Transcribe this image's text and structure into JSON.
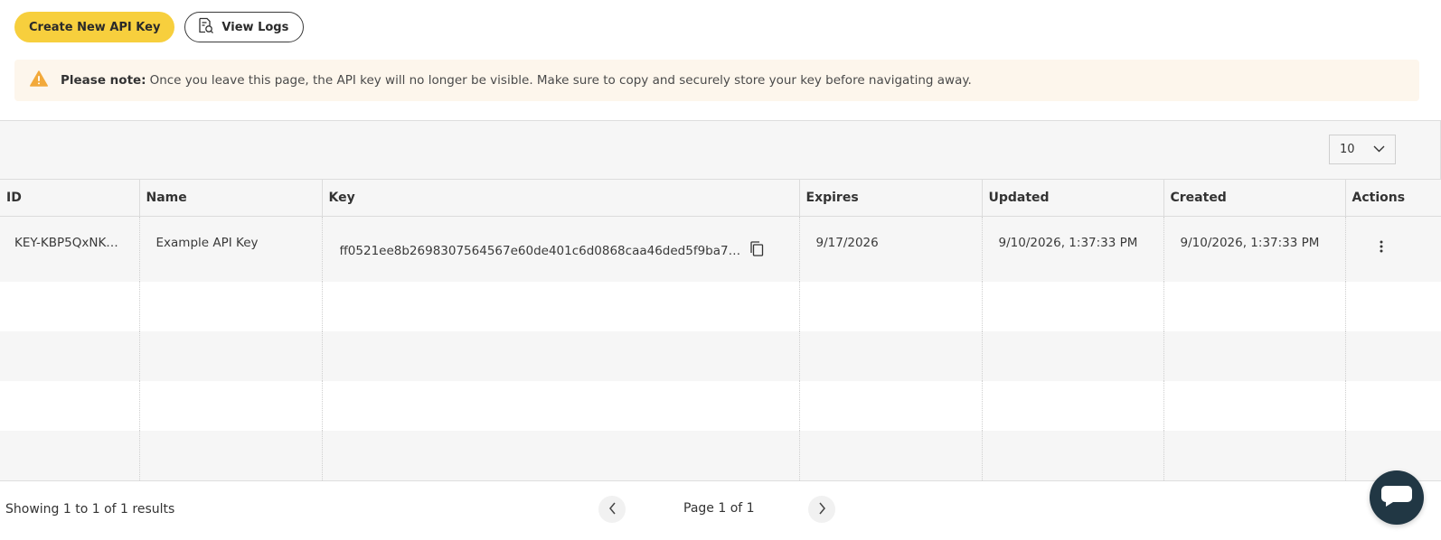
{
  "toolbar": {
    "create_label": "Create New API Key",
    "logs_label": "View Logs"
  },
  "notice": {
    "title": "Please note:",
    "message": "Once you leave this page, the API key will no longer be visible. Make sure to copy and securely store your key before navigating away."
  },
  "page_size": "10",
  "columns": [
    "ID",
    "Name",
    "Key",
    "Expires",
    "Updated",
    "Created",
    "Actions"
  ],
  "rows": [
    {
      "id": "KEY-KBP5QxNK…",
      "name": "Example API Key",
      "key": "ff0521ee8b2698307564567e60de401c6d0868caa46ded5f9ba7…",
      "expires": "9/17/2026",
      "updated": "9/10/2026, 1:37:33 PM",
      "created": "9/10/2026, 1:37:33 PM"
    }
  ],
  "footer": {
    "showing": "Showing 1 to 1 of 1 results",
    "page": "Page 1 of 1"
  },
  "colors": {
    "accent": "#f7cf3d",
    "notice_bg": "#fdf6ec",
    "warning": "#f2a93b",
    "chat": "#213744"
  },
  "icons": [
    "search-document-icon",
    "warning-icon",
    "chevron-down-icon",
    "copy-icon",
    "kebab-menu-icon",
    "chevron-left-icon",
    "chevron-right-icon",
    "chat-icon"
  ]
}
